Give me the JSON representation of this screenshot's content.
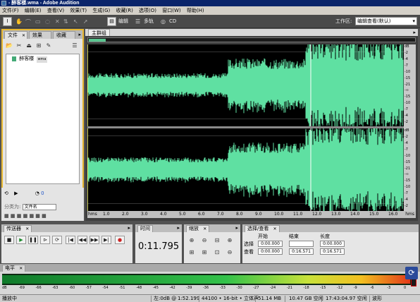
{
  "window": {
    "title": "- 醉客楼.wma - Adobe Audition"
  },
  "menu": [
    "文件(F)",
    "编辑(E)",
    "查看(V)",
    "效果(T)",
    "生成(G)",
    "收藏(R)",
    "选项(O)",
    "窗口(W)",
    "帮助(H)"
  ],
  "toolbar": {
    "edit_view_label": "编辑",
    "multitrack_label": "多轨",
    "cd_label": "CD",
    "workspace_label": "工作区:",
    "workspace_value": "编辑查看(默认)"
  },
  "files_panel": {
    "tabs": [
      "文件",
      "效果",
      "收藏"
    ],
    "file_name": "醉客楼",
    "file_badge": "wma",
    "sort_label": "分类为:",
    "sort_value": "文件名",
    "volume_value": "0"
  },
  "main": {
    "tab_label": "主群组",
    "db_labels_top": [
      "dB",
      "-2",
      "-4",
      "-7",
      "-10",
      "-15",
      "-21",
      "-∞",
      "-15",
      "-10",
      "-7",
      "-4",
      "-2"
    ],
    "db_labels_bottom": [
      "dB",
      "-2",
      "-4",
      "-7",
      "-10",
      "-15",
      "-21",
      "-∞",
      "-15",
      "-10",
      "-7",
      "-4",
      "-2"
    ],
    "ruler_start": "hms",
    "ruler_end": "hms",
    "ruler_ticks": [
      "1.0",
      "2.0",
      "3.0",
      "4.0",
      "5.0",
      "6.0",
      "7.0",
      "8.0",
      "9.0",
      "10.0",
      "11.0",
      "12.0",
      "13.0",
      "14.0",
      "15.0",
      "16.0"
    ],
    "waveform_color": "#5fe0a2"
  },
  "transport": {
    "title": "传送器"
  },
  "time": {
    "title": "时间",
    "value": "0:11.795"
  },
  "zoom": {
    "title": "缩放"
  },
  "selection": {
    "title": "选择/查看",
    "col_start": "开始",
    "col_end": "结束",
    "col_length": "长度",
    "row_selection": "选择",
    "row_view": "查看",
    "sel_start": "0:00.000",
    "sel_end": "",
    "sel_length": "0:00.000",
    "view_start": "0:00.000",
    "view_end": "0:16.571",
    "view_length": "0:16.571"
  },
  "level": {
    "title": "电平",
    "scale": [
      "dB",
      "-69",
      "-66",
      "-63",
      "-60",
      "-57",
      "-54",
      "-51",
      "-48",
      "-45",
      "-42",
      "-39",
      "-36",
      "-33",
      "-30",
      "-27",
      "-24",
      "-21",
      "-18",
      "-15",
      "-12",
      "-9",
      "-6",
      "-3",
      "0"
    ],
    "level_fraction": 0.99
  },
  "status": {
    "state": "播放中",
    "left_level": "左:0dB @",
    "position": "1:52.199",
    "format": "44100 • 16-bit • 立体声",
    "file_size": "51.14 MB",
    "free_space": "10.47 GB 空闲",
    "free_time": "17:43:04.97 空闲",
    "zoom_hint": "波形"
  }
}
